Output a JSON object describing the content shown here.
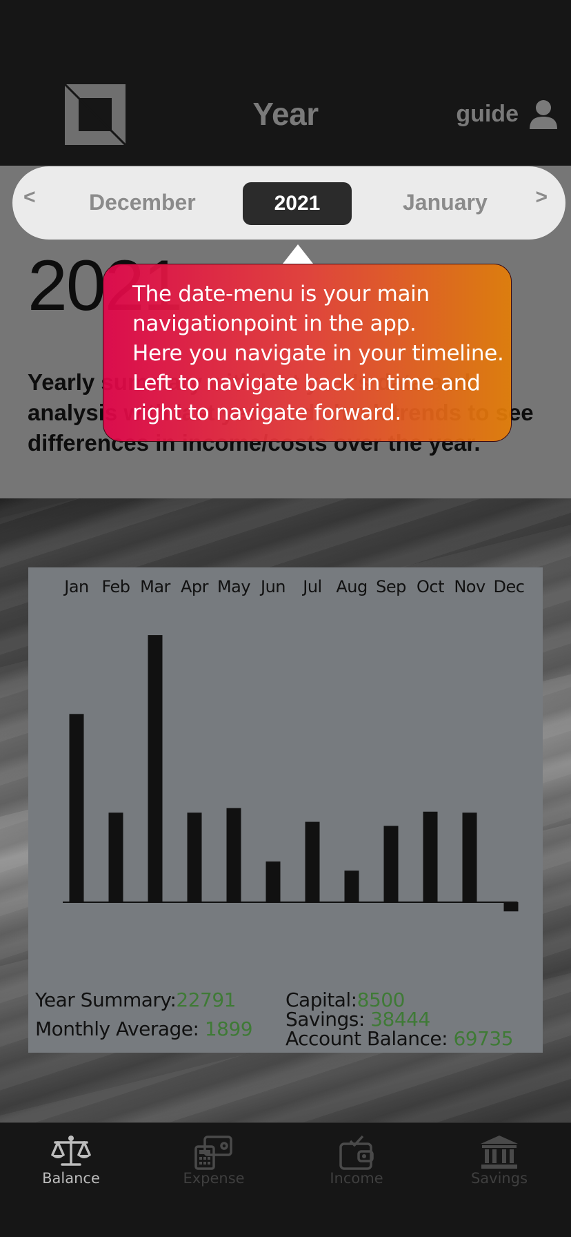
{
  "header": {
    "title": "Year",
    "guide_label": "guide"
  },
  "date_menu": {
    "prev_arrow": "<",
    "prev_label": "December",
    "current_label": "2021",
    "next_label": "January",
    "next_arrow": ">"
  },
  "page": {
    "year_heading": "2021",
    "description": "Yearly summary with last year's data and analysis with last year and check trends to see differences in income/costs over the year."
  },
  "tooltip": {
    "lines": [
      "The date-menu is your main",
      "navigationpoint in the app.",
      "Here you navigate in your timeline.",
      "Left to navigate back in time and",
      "right to navigate forward."
    ]
  },
  "chart_data": {
    "type": "bar",
    "categories": [
      "Jan",
      "Feb",
      "Mar",
      "Apr",
      "May",
      "Jun",
      "Jul",
      "Aug",
      "Sep",
      "Oct",
      "Nov",
      "Dec"
    ],
    "values": [
      3700,
      1760,
      5250,
      1760,
      1850,
      800,
      1580,
      620,
      1500,
      1780,
      1760,
      -180
    ],
    "title": "",
    "xlabel": "",
    "ylabel": "",
    "colors": {
      "bar": "#111111",
      "card": "#777b7f",
      "value_text": "#3f7a36"
    }
  },
  "summary": {
    "year_summary_label": "Year Summary:",
    "year_summary_value": "22791",
    "monthly_average_label": "Monthly Average:",
    "monthly_average_value": "1899",
    "capital_label": "Capital:",
    "capital_value": "8500",
    "savings_label": "Savings:",
    "savings_value": "38444",
    "account_balance_label": "Account Balance:",
    "account_balance_value": "69735"
  },
  "tabs": [
    {
      "label": "Balance",
      "icon": "scale-icon",
      "active": true
    },
    {
      "label": "Expense",
      "icon": "calculator-wallet-icon",
      "active": false
    },
    {
      "label": "Income",
      "icon": "wallet-check-icon",
      "active": false
    },
    {
      "label": "Savings",
      "icon": "bank-icon",
      "active": false
    }
  ]
}
